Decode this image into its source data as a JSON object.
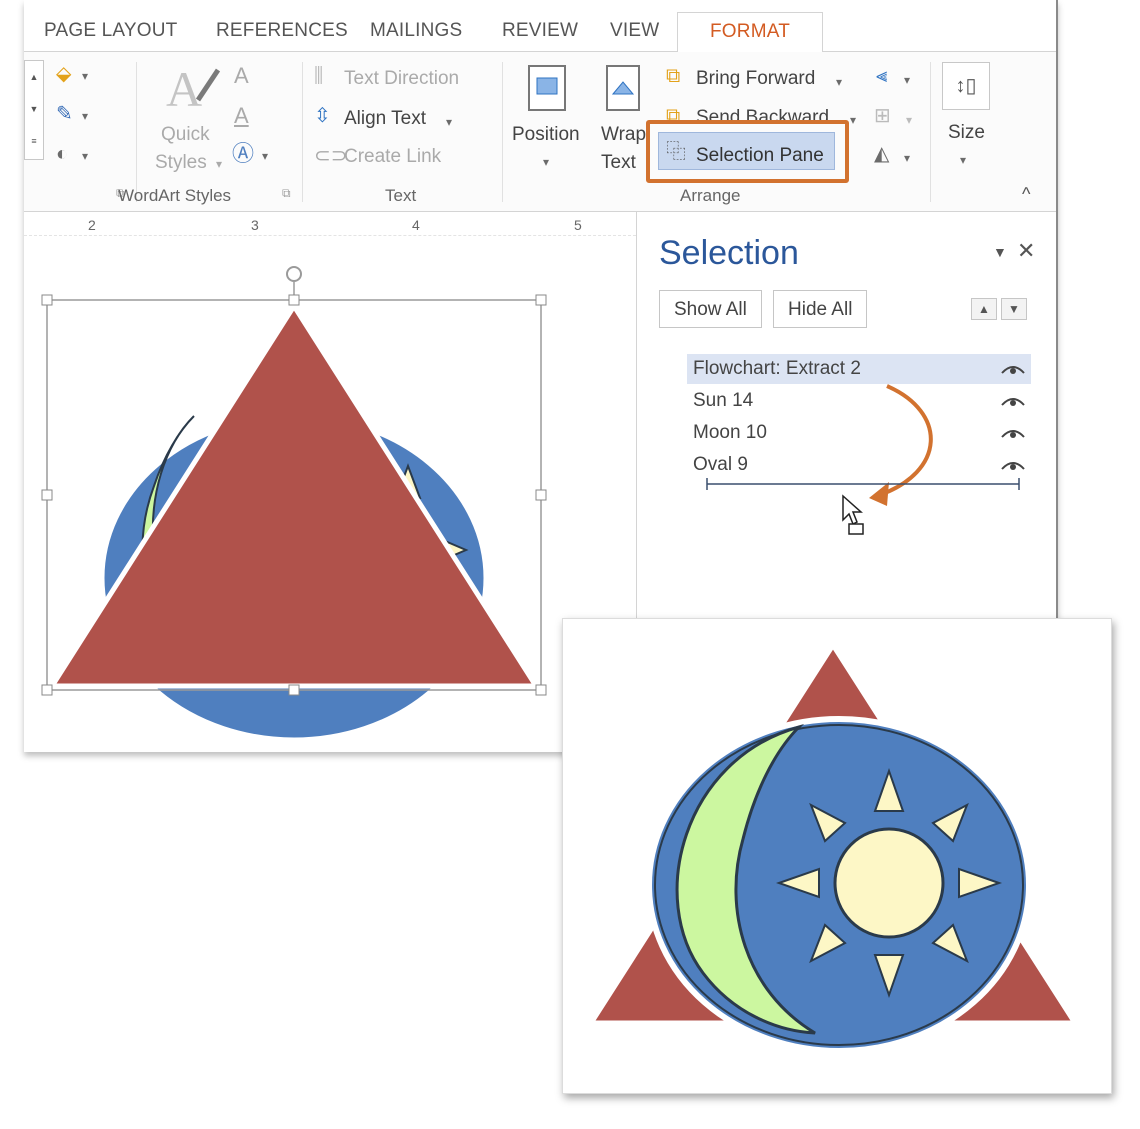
{
  "ribbon_tabs": {
    "page_layout": "PAGE LAYOUT",
    "references": "REFERENCES",
    "mailings": "MAILINGS",
    "review": "REVIEW",
    "view": "VIEW",
    "format": "FORMAT"
  },
  "ribbon": {
    "quick_styles_line1": "Quick",
    "quick_styles_line2": "Styles",
    "wordart_styles_group": "WordArt Styles",
    "text_direction": "Text Direction",
    "align_text": "Align Text",
    "create_link": "Create Link",
    "text_group": "Text",
    "position": "Position",
    "wrap_text_line1": "Wrap",
    "wrap_text_line2": "Text",
    "bring_forward": "Bring Forward",
    "send_backward": "Send Backward",
    "selection_pane": "Selection Pane",
    "arrange_group": "Arrange",
    "size": "Size"
  },
  "ruler": {
    "marks": [
      "2",
      "3",
      "4",
      "5"
    ]
  },
  "selection_pane": {
    "title": "Selection",
    "show_all": "Show All",
    "hide_all": "Hide All",
    "items": [
      {
        "label": "Flowchart: Extract 2",
        "selected": true
      },
      {
        "label": "Sun 14",
        "selected": false
      },
      {
        "label": "Moon 10",
        "selected": false
      },
      {
        "label": "Oval 9",
        "selected": false
      }
    ]
  },
  "colors": {
    "accent_orange": "#d2722f",
    "triangle_red": "#b0524b",
    "circle_blue": "#4f7fbf",
    "moon_green": "#ccf7a0",
    "sun_yellow": "#fdf7c6",
    "pane_title_blue": "#2b579a"
  }
}
